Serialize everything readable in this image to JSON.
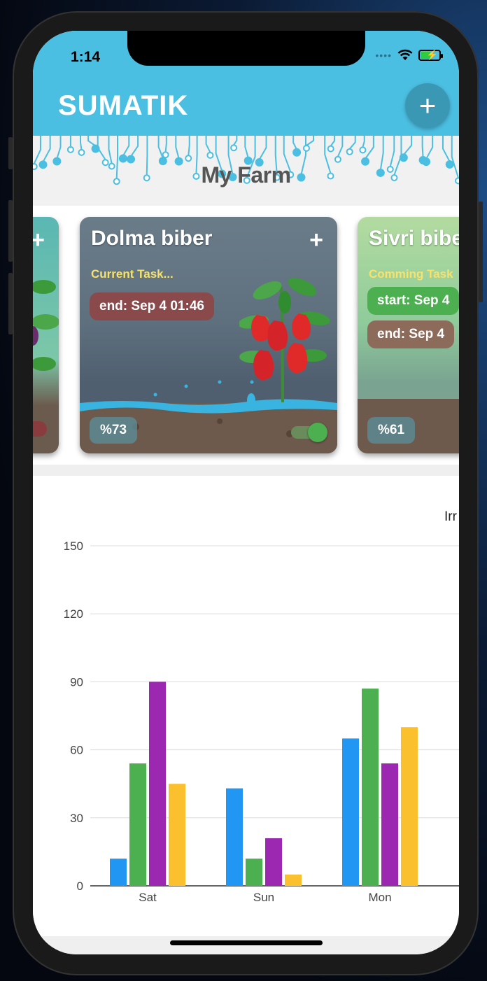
{
  "status": {
    "time": "1:14"
  },
  "app": {
    "title": "SUMATIK",
    "add_icon": "plus-icon"
  },
  "farm": {
    "title": "My Farm"
  },
  "cards": [
    {
      "name": "",
      "status": "",
      "task": "",
      "progress": "",
      "enabled": false
    },
    {
      "name": "Dolma biber",
      "status": "Current Task...",
      "end": "end: Sep 4 01:46",
      "progress": "%73",
      "enabled": true
    },
    {
      "name": "Sivri biber",
      "status": "Comming Task",
      "start": "start: Sep 4",
      "end": "end: Sep 4",
      "progress": "%61"
    }
  ],
  "colors": {
    "header": "#4bbfe2",
    "series_blue": "#2196f3",
    "series_green": "#4caf50",
    "series_purple": "#9c27b0",
    "series_yellow": "#fbc02d"
  },
  "chart_data": {
    "type": "bar",
    "title": "Irr",
    "categories": [
      "Sat",
      "Sun",
      "Mon"
    ],
    "yticks": [
      0,
      30,
      60,
      90,
      120,
      150
    ],
    "ylim": [
      0,
      150
    ],
    "grid": true,
    "series": [
      {
        "values": [
          12,
          43,
          65
        ],
        "color": "#2196f3"
      },
      {
        "values": [
          54,
          12,
          87
        ],
        "color": "#4caf50"
      },
      {
        "values": [
          90,
          21,
          54
        ],
        "color": "#9c27b0"
      },
      {
        "values": [
          45,
          5,
          70
        ],
        "color": "#fbc02d"
      }
    ]
  }
}
